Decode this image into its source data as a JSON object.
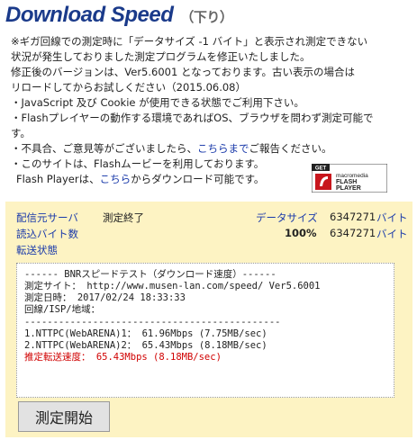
{
  "header": {
    "title": "Download Speed",
    "subtitle": "（下り）"
  },
  "notice": {
    "line1": "※ギガ回線での測定時に「データサイズ -1 バイト」と表示され測定できない",
    "line2": "状況が発生しておりました測定プログラムを修正いたしました。",
    "line3": "修正後のバージョンは、Ver5.6001 となっております。古い表示の場合は",
    "line4": "リロードしてからお試しください（2015.06.08）",
    "bullet1": "・JavaScript 及び Cookie が使用できる状態でご利用下さい。",
    "bullet2": "・Flashプレイヤーの動作する環境であればOS、ブラウザを問わず測定可能で",
    "bullet2b": "す。",
    "bullet3_pre": "・不具合、ご意見等がございましたら、",
    "bullet3_link": "こちらまで",
    "bullet3_post": "ご報告ください。",
    "bullet4": "・このサイトは、Flashムービーを利用しております。",
    "flash_pre": "Flash Playerは、",
    "flash_link": "こちら",
    "flash_post": "からダウンロード可能です。"
  },
  "flash_badge": {
    "get": "GET",
    "brand": "macromedia",
    "line1": "FLASH",
    "line2": "PLAYER"
  },
  "panel": {
    "server_label": "配信元サーバ",
    "server_status": "測定終了",
    "datasize_label": "データサイズ",
    "datasize_value": "6347271",
    "datasize_unit": "バイト",
    "bytes_read_label": "読込バイト数",
    "progress_text": "100%",
    "progress_value": 1.0,
    "bytes_read_value": "6347271",
    "bytes_read_unit": "バイト",
    "transfer_label": "転送状態"
  },
  "result": {
    "header": "------ BNRスピードテスト（ダウンロード速度）------",
    "site": "測定サイト： http://www.musen-lan.com/speed/ Ver5.6001",
    "datetime": "測定日時： 2017/02/24 18:33:33",
    "line_isp": "回線/ISP/地域：",
    "separator": "---------------------------------------------",
    "r1": "1.NTTPC(WebARENA)1： 61.96Mbps (7.75MB/sec)",
    "r2": "2.NTTPC(WebARENA)2： 65.43Mbps (8.18MB/sec)",
    "estimate": "推定転送速度： 65.43Mbps (8.18MB/sec)"
  },
  "start_button": "測定開始",
  "colors": {
    "title": "#1a3a8a",
    "link": "#1a3aaa",
    "panel_bg": "#fdf3c3",
    "estimate_red": "#d00000"
  }
}
